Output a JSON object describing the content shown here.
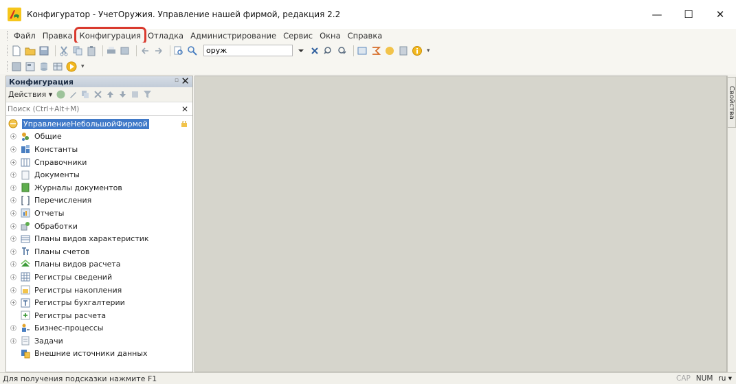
{
  "window": {
    "title": "Конфигуратор - УчетОружия. Управление нашей фирмой, редакция 2.2",
    "controls": [
      "—",
      "☐",
      "✕"
    ]
  },
  "menu": {
    "items": [
      "Файл",
      "Правка",
      "Конфигурация",
      "Отладка",
      "Администрирование",
      "Сервис",
      "Окна",
      "Справка"
    ],
    "highlighted_index": 2
  },
  "toolbar": {
    "search_value": "оруж"
  },
  "config_panel": {
    "title": "Конфигурация",
    "actions_label": "Действия ▾",
    "search_placeholder": "Поиск (Ctrl+Alt+M)",
    "root": "УправлениеНебольшойФирмой",
    "items": [
      {
        "label": "Общие",
        "icon": "common-icon",
        "expandable": true
      },
      {
        "label": "Константы",
        "icon": "constants-icon",
        "expandable": true
      },
      {
        "label": "Справочники",
        "icon": "catalogs-icon",
        "expandable": true
      },
      {
        "label": "Документы",
        "icon": "documents-icon",
        "expandable": true
      },
      {
        "label": "Журналы документов",
        "icon": "document-journals-icon",
        "expandable": true
      },
      {
        "label": "Перечисления",
        "icon": "enums-icon",
        "expandable": true
      },
      {
        "label": "Отчеты",
        "icon": "reports-icon",
        "expandable": true
      },
      {
        "label": "Обработки",
        "icon": "data-processors-icon",
        "expandable": true
      },
      {
        "label": "Планы видов характеристик",
        "icon": "chart-of-characteristic-types-icon",
        "expandable": true
      },
      {
        "label": "Планы счетов",
        "icon": "chart-of-accounts-icon",
        "expandable": true
      },
      {
        "label": "Планы видов расчета",
        "icon": "chart-of-calculation-types-icon",
        "expandable": true
      },
      {
        "label": "Регистры сведений",
        "icon": "information-registers-icon",
        "expandable": true
      },
      {
        "label": "Регистры накопления",
        "icon": "accumulation-registers-icon",
        "expandable": true
      },
      {
        "label": "Регистры бухгалтерии",
        "icon": "accounting-registers-icon",
        "expandable": true
      },
      {
        "label": "Регистры расчета",
        "icon": "calculation-registers-icon",
        "expandable": false
      },
      {
        "label": "Бизнес-процессы",
        "icon": "business-processes-icon",
        "expandable": true
      },
      {
        "label": "Задачи",
        "icon": "tasks-icon",
        "expandable": true
      },
      {
        "label": "Внешние источники данных",
        "icon": "external-data-sources-icon",
        "expandable": false
      }
    ]
  },
  "side_tab": {
    "label": "Свойства"
  },
  "status": {
    "hint": "Для получения подсказки нажмите F1",
    "cap": "CAP",
    "num": "NUM",
    "lang": "ru ▾"
  },
  "colors": {
    "selection": "#3f79c8",
    "highlight_box": "#d93a2e",
    "workspace": "#d6d5cc"
  }
}
